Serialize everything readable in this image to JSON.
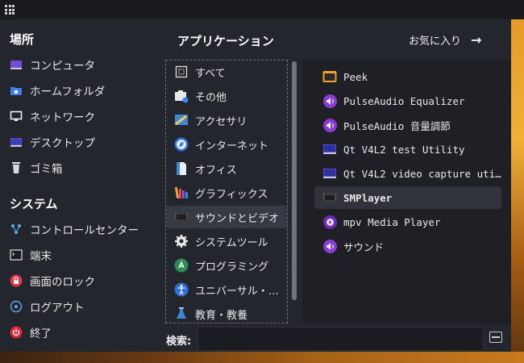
{
  "places": {
    "title": "場所",
    "items": [
      {
        "label": "コンピュータ",
        "icon": "computer-icon"
      },
      {
        "label": "ホームフォルダ",
        "icon": "home-folder-icon"
      },
      {
        "label": "ネットワーク",
        "icon": "network-icon"
      },
      {
        "label": "デスクトップ",
        "icon": "desktop-icon"
      },
      {
        "label": "ゴミ箱",
        "icon": "trash-icon"
      }
    ]
  },
  "system": {
    "title": "システム",
    "items": [
      {
        "label": "コントロールセンター",
        "icon": "control-center-icon"
      },
      {
        "label": "端末",
        "icon": "terminal-icon"
      },
      {
        "label": "画面のロック",
        "icon": "lock-icon"
      },
      {
        "label": "ログアウト",
        "icon": "logout-icon"
      },
      {
        "label": "終了",
        "icon": "power-icon"
      }
    ]
  },
  "applications": {
    "title": "アプリケーション",
    "favorites_label": "お気に入り",
    "categories": [
      {
        "label": "すべて",
        "icon": "all-icon"
      },
      {
        "label": "その他",
        "icon": "other-icon"
      },
      {
        "label": "アクセサリ",
        "icon": "accessories-icon"
      },
      {
        "label": "インターネット",
        "icon": "internet-icon"
      },
      {
        "label": "オフィス",
        "icon": "office-icon"
      },
      {
        "label": "グラフィックス",
        "icon": "graphics-icon"
      },
      {
        "label": "サウンドとビデオ",
        "icon": "sound-video-icon",
        "selected": true
      },
      {
        "label": "システムツール",
        "icon": "system-tools-icon"
      },
      {
        "label": "プログラミング",
        "icon": "programming-icon"
      },
      {
        "label": "ユニバーサル・…",
        "icon": "accessibility-icon"
      },
      {
        "label": "教育・教養",
        "icon": "education-icon"
      }
    ],
    "apps": [
      {
        "label": "Peek",
        "icon": "peek-icon"
      },
      {
        "label": "PulseAudio Equalizer",
        "icon": "speaker-icon"
      },
      {
        "label": "PulseAudio 音量調節",
        "icon": "speaker-icon"
      },
      {
        "label": "Qt V4L2 test Utility",
        "icon": "monitor-icon"
      },
      {
        "label": "Qt V4L2 video capture uti…",
        "icon": "monitor-icon"
      },
      {
        "label": "SMPlayer",
        "icon": "film-icon",
        "selected": true
      },
      {
        "label": "mpv Media Player",
        "icon": "play-icon"
      },
      {
        "label": "サウンド",
        "icon": "speaker-icon"
      }
    ]
  },
  "search": {
    "label": "検索:",
    "value": "",
    "placeholder": ""
  },
  "colors": {
    "accent_purple": "#8b3bd1",
    "panel_bg": "#24262d",
    "selection_bg": "#363a45"
  }
}
